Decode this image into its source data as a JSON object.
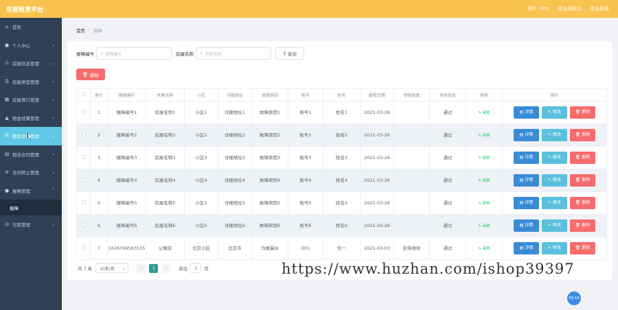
{
  "header": {
    "brand": "房屋租赁平台",
    "nav": [
      "退出到前台",
      "退出登录"
    ],
    "username": "用户: 900"
  },
  "sidebar": {
    "items": [
      {
        "label": "首页",
        "icon": "home-icon"
      },
      {
        "label": "个人中心",
        "icon": "user-icon"
      },
      {
        "label": "房屋信息管理",
        "icon": "info-icon"
      },
      {
        "label": "房屋类型管理",
        "icon": "list-icon"
      },
      {
        "label": "房屋预订管理",
        "icon": "calendar-icon"
      },
      {
        "label": "租金结算管理",
        "icon": "money-icon"
      },
      {
        "label": "租金交纳管理",
        "icon": "list-icon"
      },
      {
        "label": "租赁合同管理",
        "icon": "contract-icon"
      },
      {
        "label": "合同终止管理",
        "icon": "stop-icon"
      },
      {
        "label": "报障管理",
        "icon": "user-icon"
      }
    ],
    "sub_item": "报障",
    "last_item": {
      "label": "日程管理",
      "icon": "schedule-icon"
    }
  },
  "breadcrumb": {
    "home": "首页",
    "sep": "/",
    "current": "报障"
  },
  "search": {
    "label1": "报障编号",
    "placeholder1": "报障编号",
    "label2": "房屋名称",
    "placeholder2": "房屋名称",
    "query": "查询"
  },
  "delete_label": "删除",
  "table": {
    "headers": [
      "",
      "索引",
      "报障编号",
      "房屋名称",
      "小区",
      "详细地址",
      "故障原因",
      "账号",
      "姓名",
      "报障日期",
      "审核回复",
      "审核状态",
      "审核",
      "操作"
    ],
    "rows": [
      {
        "idx": "1",
        "code": "报障编号1",
        "name": "房屋名称1",
        "area": "小区1",
        "addr": "详细地址1",
        "reason": "故障原因1",
        "acct": "账号1",
        "person": "姓名1",
        "date": "2021-03-26",
        "reply": "",
        "status": "通过"
      },
      {
        "idx": "2",
        "code": "报障编号2",
        "name": "房屋名称2",
        "area": "小区2",
        "addr": "详细地址2",
        "reason": "故障原因2",
        "acct": "账号2",
        "person": "姓名2",
        "date": "2021-03-26",
        "reply": "",
        "status": "通过"
      },
      {
        "idx": "3",
        "code": "报障编号3",
        "name": "房屋名称3",
        "area": "小区3",
        "addr": "详细地址3",
        "reason": "故障原因3",
        "acct": "账号3",
        "person": "姓名3",
        "date": "2021-03-26",
        "reply": "",
        "status": "通过"
      },
      {
        "idx": "4",
        "code": "报障编号4",
        "name": "房屋名称4",
        "area": "小区4",
        "addr": "详细地址4",
        "reason": "故障原因4",
        "acct": "账号4",
        "person": "姓名4",
        "date": "2021-03-26",
        "reply": "",
        "status": "通过"
      },
      {
        "idx": "5",
        "code": "报障编号5",
        "name": "房屋名称5",
        "area": "小区5",
        "addr": "详细地址5",
        "reason": "故障原因5",
        "acct": "账号5",
        "person": "姓名5",
        "date": "2021-03-26",
        "reply": "",
        "status": "通过"
      },
      {
        "idx": "6",
        "code": "报障编号6",
        "name": "房屋名称6",
        "area": "小区6",
        "addr": "详细地址6",
        "reason": "故障原因6",
        "acct": "账号6",
        "person": "姓名6",
        "date": "2021-03-26",
        "reply": "",
        "status": "通过"
      },
      {
        "idx": "7",
        "code": "1616766563535",
        "name": "公寓房",
        "area": "北京小区",
        "addr": "北京市",
        "reason": "马桶漏水",
        "acct": "001",
        "person": "任一",
        "date": "2021-03-03",
        "reply": "安排维修",
        "status": "通过"
      }
    ],
    "audit_label": "审核",
    "detail_label": "详情",
    "edit_label": "修改",
    "remove_label": "删除"
  },
  "pager": {
    "total": "共 7 条",
    "size": "10条/页",
    "prev": "<",
    "page": "1",
    "next": ">",
    "goto": "前往",
    "goto_value": "1",
    "goto_unit": "页"
  },
  "watermark": "https://www.huzhan.com/ishop39397",
  "float_badge": "09:16",
  "colors": {
    "topbar": "#f8c34e",
    "sidebar": "#304156",
    "active": "#5fc8e6",
    "danger": "#f56c6c",
    "primary": "#3a8bd5",
    "info": "#5bc0de",
    "success": "#13ce66"
  }
}
